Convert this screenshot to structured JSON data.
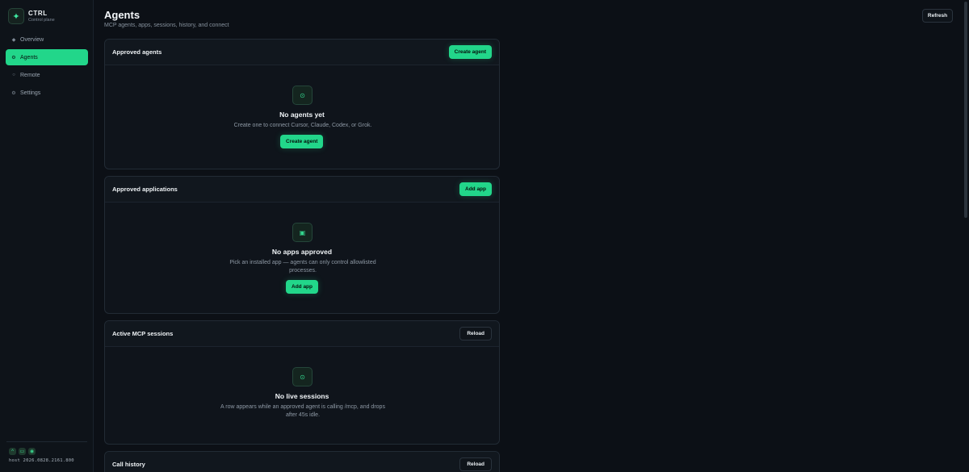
{
  "brand": {
    "name": "CTRL",
    "subtitle": "Control plane",
    "logo_icon": "sparkle-icon"
  },
  "nav": [
    {
      "label": "Overview",
      "icon": "diamond-icon",
      "active": false
    },
    {
      "label": "Agents",
      "icon": "gear-icon",
      "active": true
    },
    {
      "label": "Remote",
      "icon": "circle-icon",
      "active": false
    },
    {
      "label": "Settings",
      "icon": "settings-icon",
      "active": false
    }
  ],
  "footer": {
    "host": "host 2026.0828.2161.800",
    "icons": [
      "chevron-up-icon",
      "monitor-icon",
      "eye-icon"
    ]
  },
  "header": {
    "title": "Agents",
    "subtitle": "MCP agents, apps, sessions, history, and connect",
    "refresh_label": "Refresh"
  },
  "cards": {
    "agents": {
      "title": "Approved agents",
      "action_label": "Create agent",
      "empty_title": "No agents yet",
      "empty_desc": "Create one to connect Cursor, Claude, Codex, or Grok.",
      "empty_button": "Create agent"
    },
    "apps": {
      "title": "Approved applications",
      "action_label": "Add app",
      "empty_title": "No apps approved",
      "empty_desc": "Pick an installed app — agents can only control allowlisted processes.",
      "empty_button": "Add app"
    },
    "sessions": {
      "title": "Active MCP sessions",
      "action_label": "Reload",
      "empty_title": "No live sessions",
      "empty_desc": "A row appears while an approved agent is calling /mcp, and drops after 45s idle."
    },
    "history": {
      "title": "Call history",
      "action_label": "Reload"
    }
  },
  "colors": {
    "accent": "#22d68a",
    "background": "#0c1016",
    "card": "#0f141b"
  }
}
